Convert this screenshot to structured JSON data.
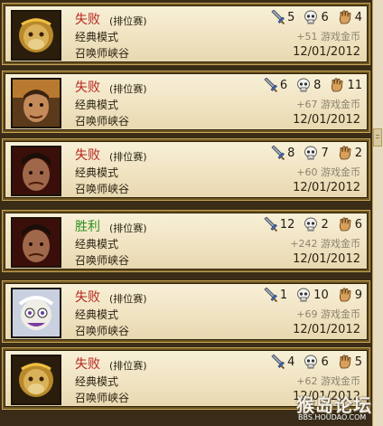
{
  "matches": [
    {
      "result": "失败",
      "type": "loss",
      "queue": "(排位赛)",
      "mode": "经典模式",
      "map": "召唤师峡谷",
      "kills": "5",
      "deaths": "6",
      "assists": "4",
      "gold": "+51 游戏金币",
      "date": "12/01/2012",
      "champion": "monkey"
    },
    {
      "result": "失败",
      "type": "loss",
      "queue": "(排位赛)",
      "mode": "经典模式",
      "map": "召唤师峡谷",
      "kills": "6",
      "deaths": "8",
      "assists": "11",
      "gold": "+67 游戏金币",
      "date": "12/01/2012",
      "champion": "warrior"
    },
    {
      "result": "失败",
      "type": "loss",
      "queue": "(排位赛)",
      "mode": "经典模式",
      "map": "召唤师峡谷",
      "kills": "8",
      "deaths": "7",
      "assists": "2",
      "gold": "+60 游戏金币",
      "date": "12/01/2012",
      "champion": "brute"
    },
    {
      "result": "胜利",
      "type": "win",
      "queue": "(排位赛)",
      "mode": "经典模式",
      "map": "召唤师峡谷",
      "kills": "12",
      "deaths": "2",
      "assists": "6",
      "gold": "+242 游戏金币",
      "date": "12/01/2012",
      "champion": "brute"
    },
    {
      "result": "失败",
      "type": "loss",
      "queue": "(排位赛)",
      "mode": "经典模式",
      "map": "召唤师峡谷",
      "kills": "1",
      "deaths": "10",
      "assists": "9",
      "gold": "+69 游戏金币",
      "date": "12/01/2012",
      "champion": "yordle"
    },
    {
      "result": "失败",
      "type": "loss",
      "queue": "(排位赛)",
      "mode": "经典模式",
      "map": "召唤师峡谷",
      "kills": "4",
      "deaths": "6",
      "assists": "5",
      "gold": "+62 游戏金币",
      "date": "12/01/2012",
      "champion": "monkey"
    }
  ],
  "icons": {
    "kills": "sword-icon",
    "deaths": "skull-icon",
    "assists": "hand-icon"
  },
  "colors": {
    "loss": "#b6271d",
    "win": "#2f8f1f",
    "frame": "#6e5520"
  },
  "watermark": {
    "text": "猴岛论坛",
    "sub": "BBS.HOUDAO.COM"
  }
}
